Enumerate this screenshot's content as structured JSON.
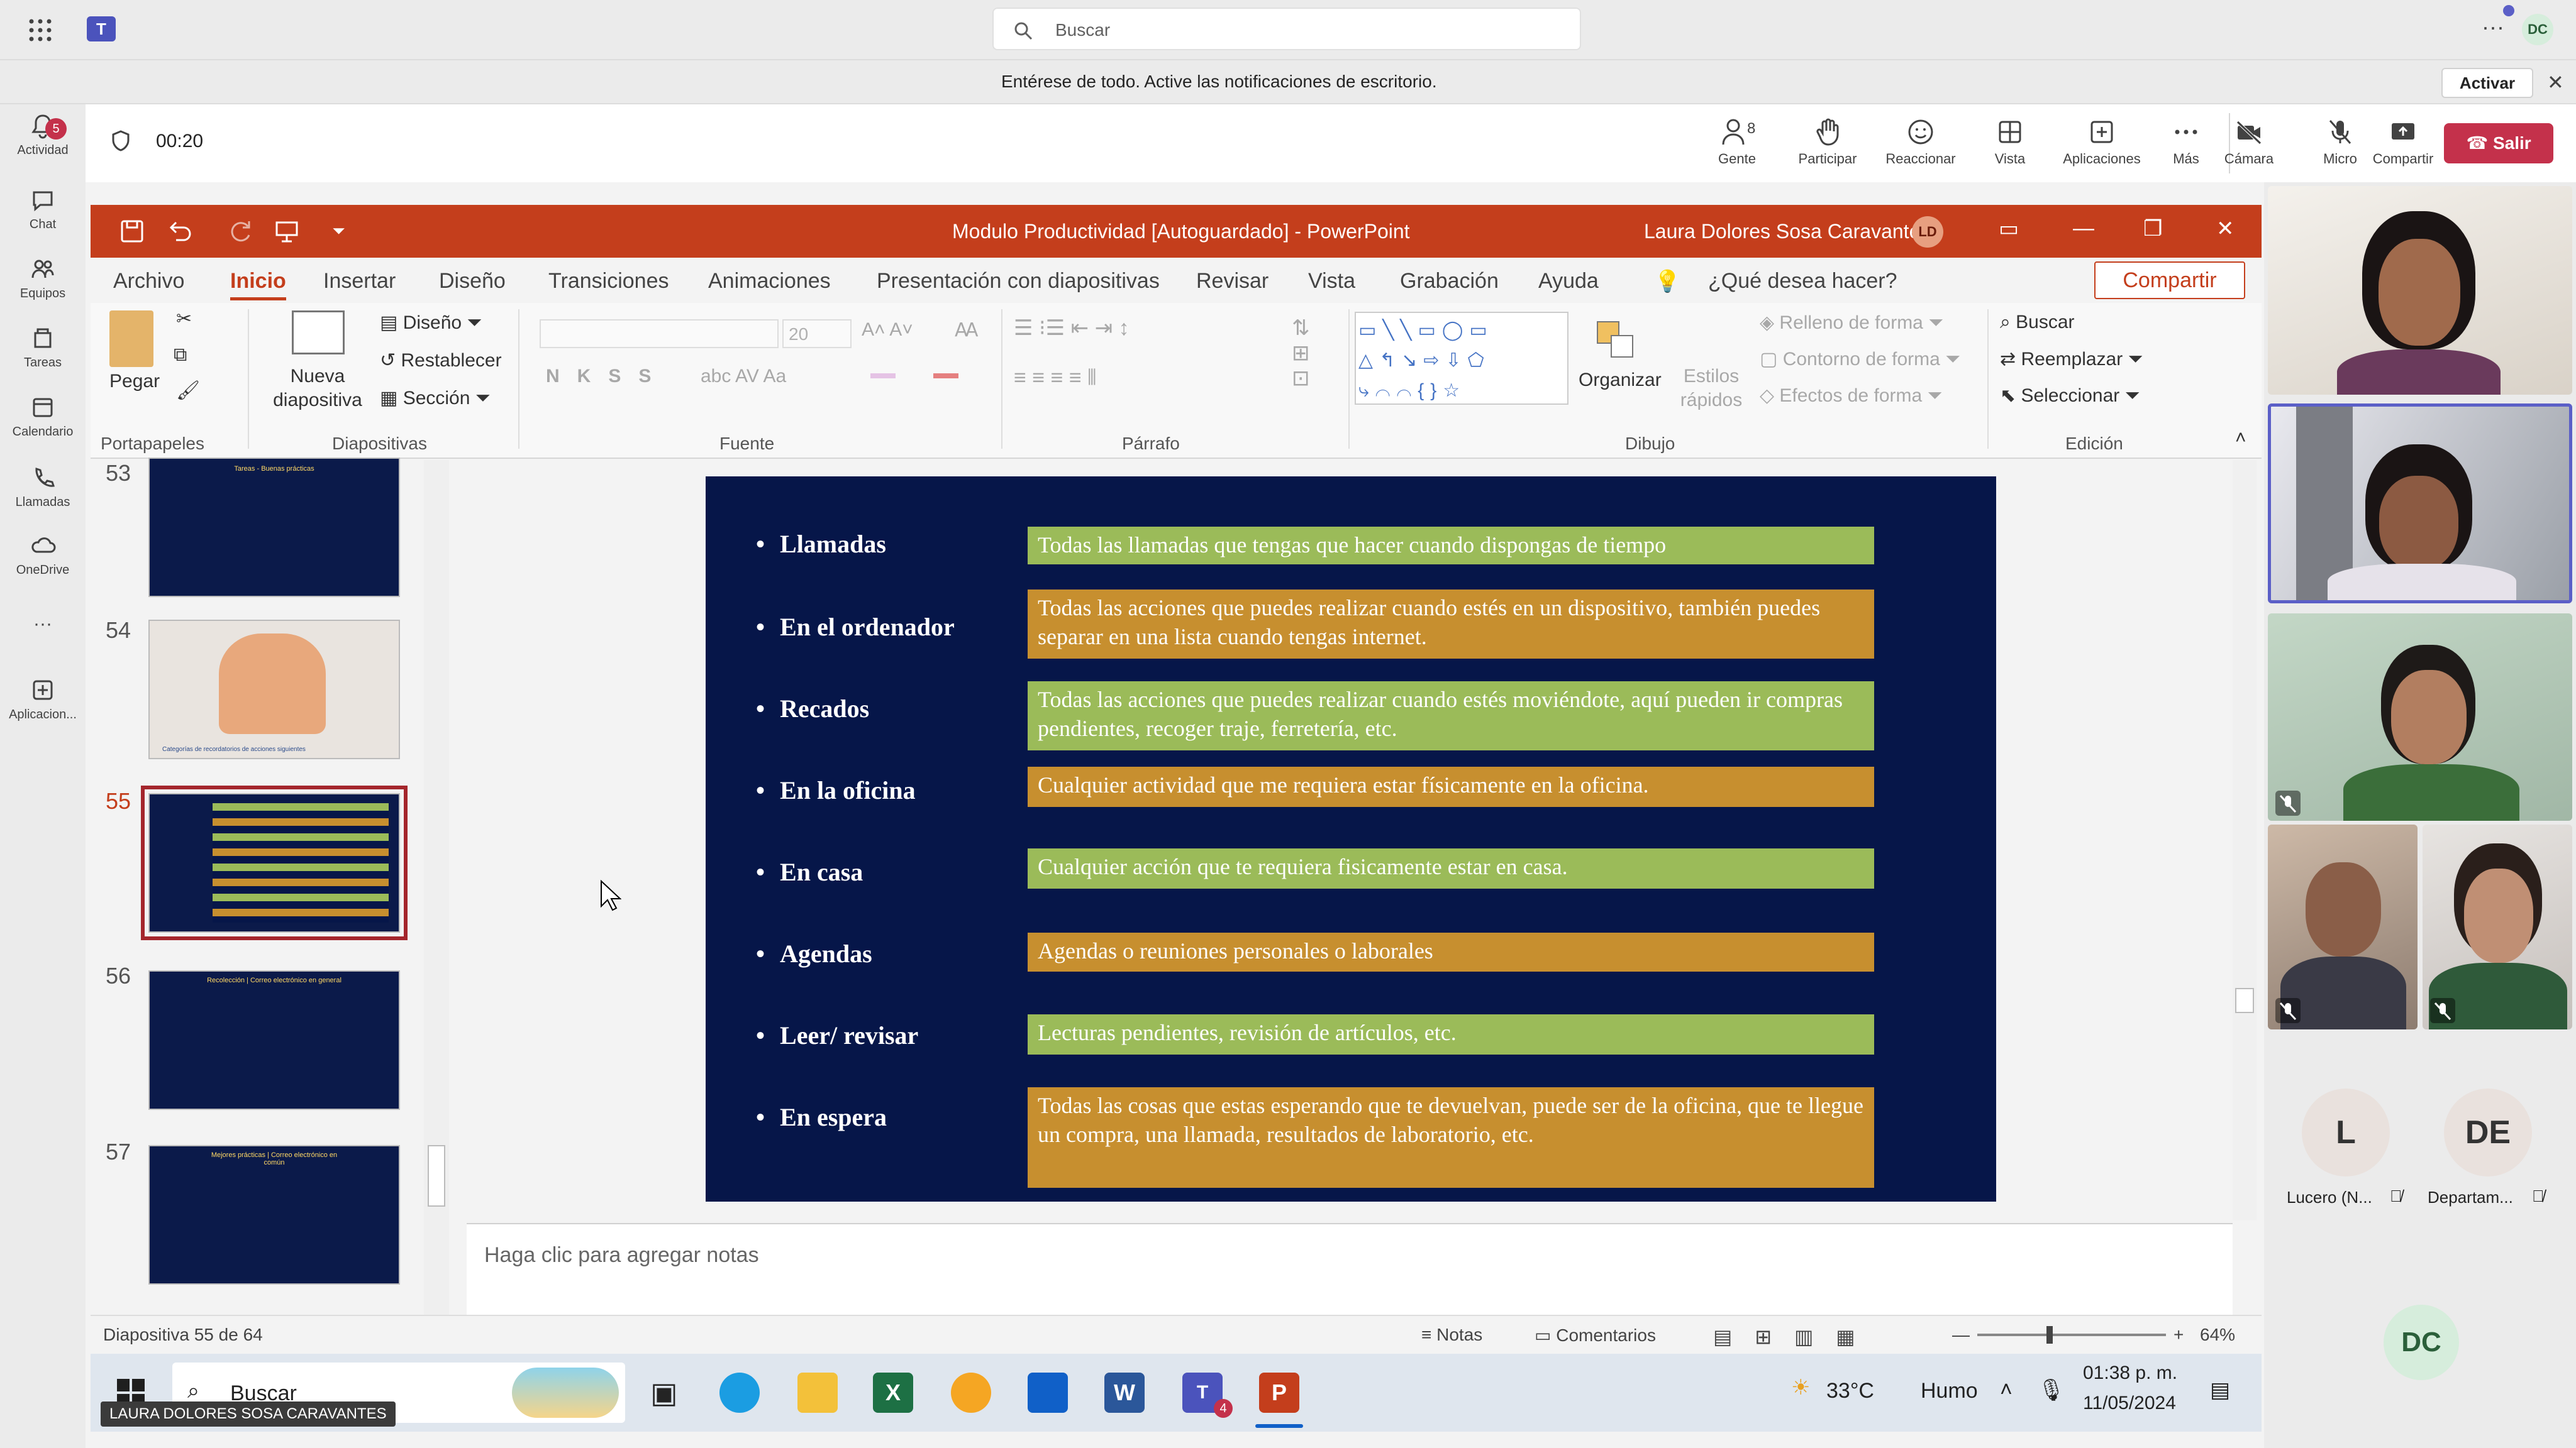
{
  "teams": {
    "search_placeholder": "Buscar",
    "avatar_initials": "DC",
    "more": "···",
    "rail": [
      {
        "label": "Actividad",
        "badge": "5"
      },
      {
        "label": "Chat"
      },
      {
        "label": "Equipos"
      },
      {
        "label": "Tareas"
      },
      {
        "label": "Calendario"
      },
      {
        "label": "Llamadas"
      },
      {
        "label": "OneDrive"
      },
      {
        "label": "···"
      },
      {
        "label": "Aplicacion..."
      }
    ],
    "banner": {
      "text": "Entérese de todo. Active las notificaciones de escritorio.",
      "button": "Activar",
      "close": "✕"
    }
  },
  "meeting": {
    "timer": "00:20",
    "people_count": "8",
    "controls": [
      "Gente",
      "Participar",
      "Reaccionar",
      "Vista",
      "Aplicaciones",
      "Más",
      "Cámara",
      "Micro",
      "Compartir"
    ],
    "leave": "Salir"
  },
  "ppt": {
    "title": "Modulo Productividad [Autoguardado]  -  PowerPoint",
    "user": "Laura Dolores Sosa Caravantes",
    "user_initials": "LD",
    "tabs": [
      "Archivo",
      "Inicio",
      "Insertar",
      "Diseño",
      "Transiciones",
      "Animaciones",
      "Presentación con diapositivas",
      "Revisar",
      "Vista",
      "Grabación",
      "Ayuda",
      "¿Qué desea hacer?"
    ],
    "active_tab": "Inicio",
    "share": "Compartir",
    "ribbon": {
      "paste": "Pegar",
      "new_slide": "Nueva diapositiva",
      "layout": "Diseño",
      "reset": "Restablecer",
      "section": "Sección",
      "font_size": "20",
      "organize": "Organizar",
      "quick_styles": "Estilos rápidos",
      "fill": "Relleno de forma",
      "outline": "Contorno de forma",
      "effects": "Efectos de forma",
      "find": "Buscar",
      "replace": "Reemplazar",
      "select": "Seleccionar",
      "groups": [
        "Portapapeles",
        "Diapositivas",
        "Fuente",
        "Párrafo",
        "Dibujo",
        "Edición"
      ]
    },
    "thumb_numbers": [
      "53",
      "54",
      "55",
      "56",
      "57"
    ],
    "thumb_captions": {
      "53": "Tareas - Buenas prácticas",
      "54": "Categorías de recordatorios de acciones siguientes",
      "56": "Recolección | Correo electrónico en general",
      "57": "Mejores prácticas | Correo electrónico en común"
    },
    "slide_rows": [
      {
        "label": "Llamadas",
        "text": "Todas las llamadas que tengas que hacer cuando dispongas de tiempo",
        "color": "green"
      },
      {
        "label": "En el ordenador",
        "text": "Todas las acciones que puedes realizar cuando estés en un dispositivo, también puedes separar en una lista cuando tengas internet.",
        "color": "orange"
      },
      {
        "label": "Recados",
        "text": "Todas las acciones que puedes realizar cuando estés moviéndote, aquí pueden ir compras pendientes, recoger traje, ferretería, etc.",
        "color": "green"
      },
      {
        "label": "En la oficina",
        "text": "Cualquier actividad que me requiera estar físicamente en la oficina.",
        "color": "orange"
      },
      {
        "label": "En casa",
        "text": "Cualquier acción que te requiera fisicamente estar en casa.",
        "color": "green"
      },
      {
        "label": "Agendas",
        "text": "Agendas o reuniones personales o laborales",
        "color": "orange"
      },
      {
        "label": "Leer/ revisar",
        "text": "Lecturas pendientes, revisión de artículos, etc.",
        "color": "green"
      },
      {
        "label": "En espera",
        "text": "Todas las cosas que estas esperando que te devuelvan, puede ser de la oficina, que te llegue un compra, una llamada, resultados de laboratorio, etc.",
        "color": "orange"
      }
    ],
    "notes_placeholder": "Haga clic para agregar notas",
    "status": {
      "slide": "Diapositiva 55 de 64",
      "notes": "Notas",
      "comments": "Comentarios",
      "zoom": "64%"
    }
  },
  "taskbar": {
    "search": "Buscar",
    "weather_temp": "33°C",
    "weather_desc": "Humo",
    "time": "01:38 p. m.",
    "date": "11/05/2024",
    "teams_badge": "4",
    "presenter": "LAURA DOLORES SOSA CARAVANTES"
  },
  "gallery": {
    "participants": [
      {
        "initials": "L",
        "name": "Lucero (N..."
      },
      {
        "initials": "DE",
        "name": "Departam..."
      }
    ],
    "self_initials": "DC"
  },
  "colors": {
    "ppt_red": "#c43e1c",
    "teams_purple": "#5b5fc7",
    "leave_red": "#c4314b",
    "slide_bg": "#061649",
    "green": "#9bbb59",
    "orange": "#c78f2f"
  }
}
